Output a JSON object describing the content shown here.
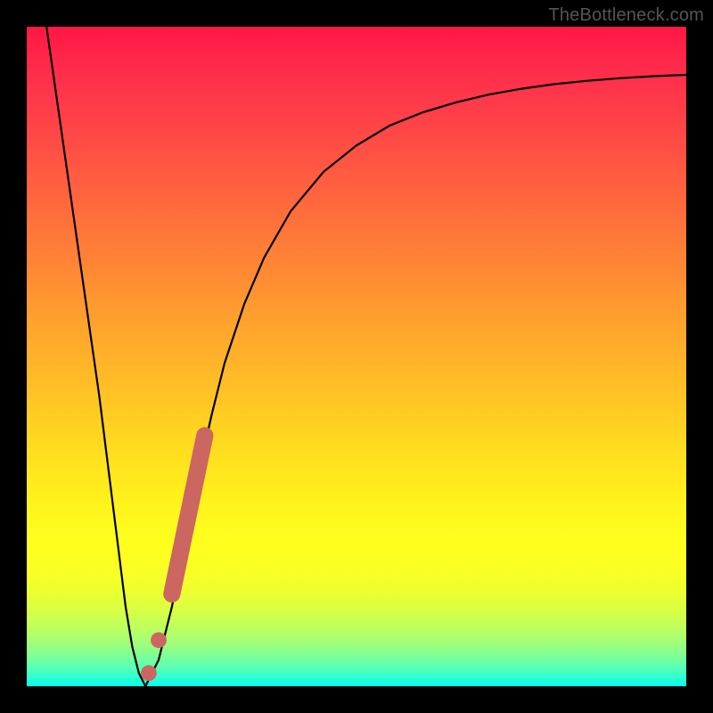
{
  "watermark": "TheBottleneck.com",
  "colors": {
    "page_bg": "#000000",
    "curve": "#000000",
    "marker": "#cc6660",
    "gradient_top": "#ff1744",
    "gradient_bottom": "#00ffee"
  },
  "chart_data": {
    "type": "line",
    "title": "",
    "xlabel": "",
    "ylabel": "",
    "xlim": [
      0,
      100
    ],
    "ylim": [
      0,
      100
    ],
    "grid": false,
    "legend": false,
    "series": [
      {
        "name": "bottleneck-curve",
        "color": "#000000",
        "x": [
          3,
          5,
          7,
          9,
          11,
          12,
          13,
          14,
          15,
          16,
          17,
          18,
          20,
          22,
          24,
          26,
          28,
          30,
          33,
          36,
          40,
          45,
          50,
          55,
          60,
          65,
          70,
          75,
          80,
          85,
          90,
          95,
          100
        ],
        "y": [
          100,
          86,
          72,
          58,
          44,
          36,
          28,
          20,
          12,
          6,
          2,
          0,
          4,
          12,
          22,
          32,
          41,
          49,
          58,
          65,
          72,
          78,
          82,
          85,
          87,
          88.5,
          89.7,
          90.6,
          91.3,
          91.8,
          92.2,
          92.5,
          92.7
        ]
      }
    ],
    "markers": [
      {
        "name": "marker-dot-lower",
        "x": 18.5,
        "y": 2,
        "r": 1.2
      },
      {
        "name": "marker-dot-upper",
        "x": 20,
        "y": 7,
        "r": 1.2
      },
      {
        "name": "marker-bar",
        "x0": 22,
        "y0": 14,
        "x1": 27,
        "y1": 38,
        "width": 2.6
      }
    ]
  }
}
